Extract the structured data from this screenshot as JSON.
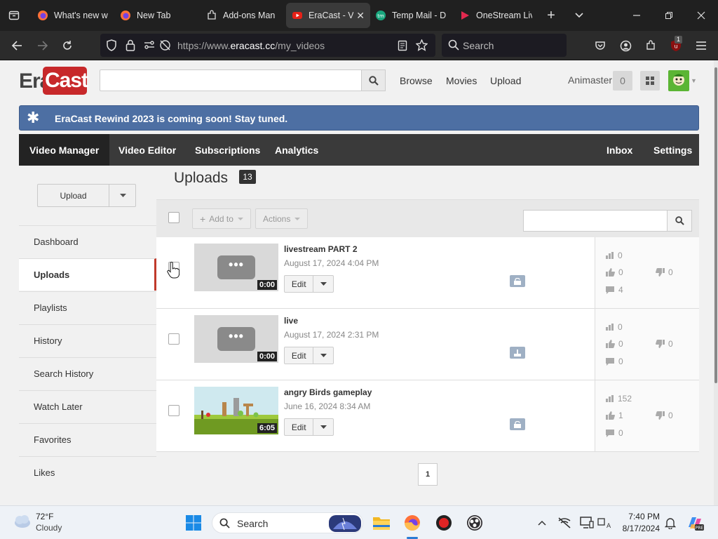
{
  "browser": {
    "tabs": [
      {
        "label": "What's new w",
        "icon": "firefox-icon"
      },
      {
        "label": "New Tab",
        "icon": "firefox-icon"
      },
      {
        "label": "Add-ons Man",
        "icon": "puzzle-icon"
      },
      {
        "label": "EraCast - Vi",
        "icon": "youtube-icon",
        "active": true
      },
      {
        "label": "Temp Mail - D",
        "icon": "tempmail-icon"
      },
      {
        "label": "OneStream Liv",
        "icon": "play-icon"
      }
    ],
    "url_prefix": "https://www.",
    "url_domain": "eracast.cc",
    "url_path": "/my_videos",
    "search_placeholder": "Search",
    "extension_badge": "1"
  },
  "site": {
    "logo_era": "Era",
    "logo_cast": "Cast",
    "search_placeholder": "",
    "nav": [
      "Browse",
      "Movies",
      "Upload"
    ],
    "username": "Animaster",
    "notification_count": "0",
    "banner": "EraCast Rewind 2023 is coming soon! Stay tuned.",
    "tabs_left": [
      "Video Manager",
      "Video Editor",
      "Subscriptions",
      "Analytics"
    ],
    "tabs_right": [
      "Inbox",
      "Settings"
    ],
    "upload_button": "Upload",
    "sidebar": [
      "Dashboard",
      "Uploads",
      "Playlists",
      "History",
      "Search History",
      "Watch Later",
      "Favorites",
      "Likes"
    ],
    "sidebar_active": "Uploads",
    "uploads_title": "Uploads",
    "uploads_count": "13",
    "toolbar": {
      "add_to": "Add to",
      "actions": "Actions"
    },
    "videos": [
      {
        "title": "livestream PART 2",
        "date": "August 17, 2024 4:04 PM",
        "duration": "0:00",
        "edit": "Edit",
        "views": "0",
        "likes": "0",
        "dislikes": "0",
        "comments": "4",
        "thumb": "placeholder",
        "privacy": "private"
      },
      {
        "title": "live",
        "date": "August 17, 2024 2:31 PM",
        "duration": "0:00",
        "edit": "Edit",
        "views": "0",
        "likes": "0",
        "dislikes": "0",
        "comments": "0",
        "thumb": "placeholder",
        "privacy": "public"
      },
      {
        "title": "angry Birds gameplay",
        "date": "June 16, 2024 8:34 AM",
        "duration": "6:05",
        "edit": "Edit",
        "views": "152",
        "likes": "1",
        "dislikes": "0",
        "comments": "0",
        "thumb": "game",
        "privacy": "private"
      }
    ],
    "page": "1"
  },
  "taskbar": {
    "weather_temp": "72°F",
    "weather_desc": "Cloudy",
    "search": "Search",
    "time": "7:40 PM",
    "date": "8/17/2024"
  }
}
